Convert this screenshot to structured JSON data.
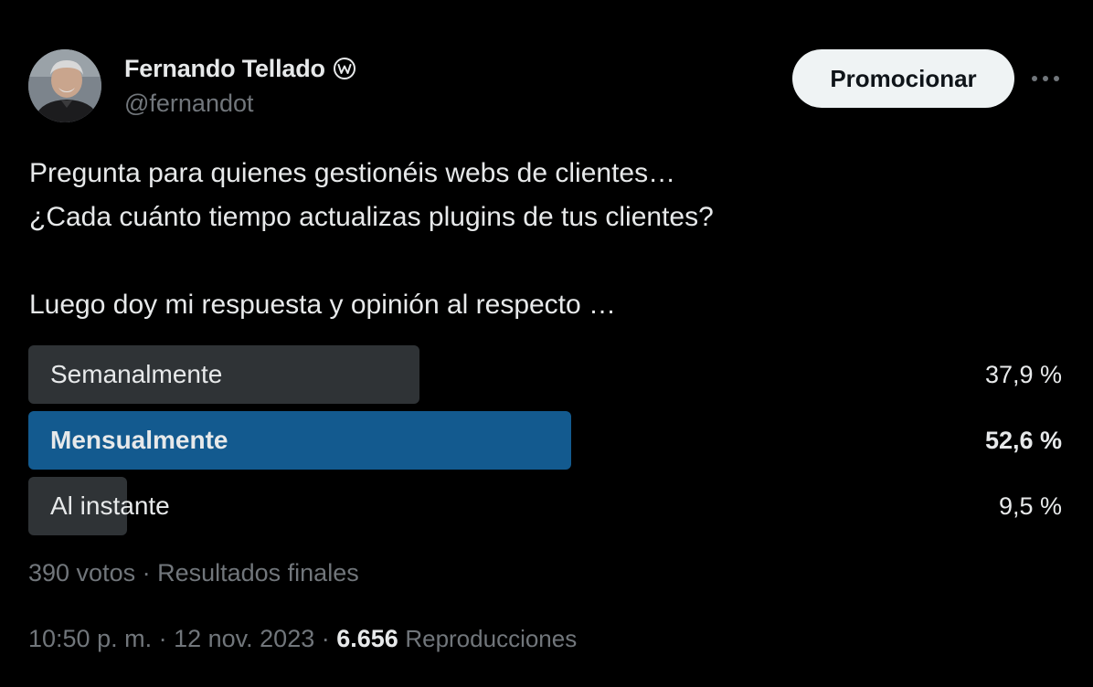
{
  "author": {
    "name": "Fernando Tellado",
    "handle": "@fernandot",
    "verified_icon": "wordpress-badge-icon"
  },
  "header": {
    "promote_label": "Promocionar",
    "more_icon": "more-horizontal-icon"
  },
  "tweet": {
    "lines": [
      "Pregunta para quienes gestionéis webs de clientes…",
      "¿Cada cuánto tiempo actualizas plugins de tus clientes?",
      "",
      "Luego doy mi respuesta y opinión al respecto …"
    ]
  },
  "poll": {
    "options": [
      {
        "label": "Semanalmente",
        "percent_text": "37,9 %",
        "percent": 37.9,
        "winner": false
      },
      {
        "label": "Mensualmente",
        "percent_text": "52,6 %",
        "percent": 52.6,
        "winner": true
      },
      {
        "label": "Al instante",
        "percent_text": "9,5 %",
        "percent": 9.5,
        "winner": false
      }
    ],
    "meta": "390 votos · Resultados finales"
  },
  "meta": {
    "time": "10:50 p. m.",
    "separator": " · ",
    "date": "12 nov. 2023",
    "views_count": "6.656",
    "views_label": "Reproducciones"
  },
  "colors": {
    "background": "#000000",
    "text": "#e7e9ea",
    "muted": "#71767b",
    "poll_bar": "#2f3336",
    "poll_winner": "#135a8f",
    "button_bg": "#eff3f4"
  }
}
